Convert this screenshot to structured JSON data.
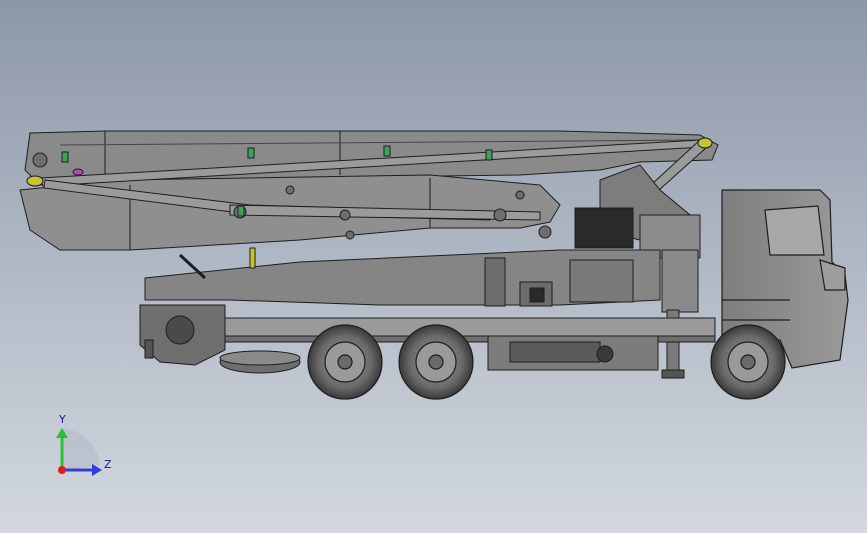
{
  "view": {
    "triad": {
      "y_label": "Y",
      "z_label": "Z"
    }
  },
  "colors": {
    "background_top": "#8c97a8",
    "background_bottom": "#d3d8df",
    "body_fill": "#8d8d8d",
    "dark_fill": "#2a2a2a",
    "outline": "#1e1e1e",
    "accent_green": "#3aa35b",
    "accent_yellow": "#c8c23b",
    "triad_y": "#2bbf3a",
    "triad_z": "#2f3fd6",
    "triad_origin": "#d42020"
  }
}
